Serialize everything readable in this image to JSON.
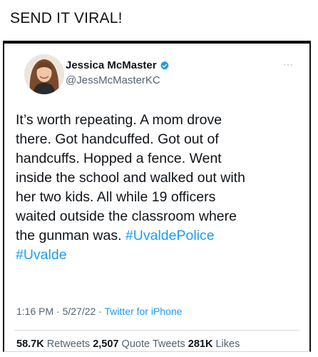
{
  "caption": "SEND IT VIRAL!",
  "tweet": {
    "author_name": "Jessica McMaster",
    "handle": "@JessMcMasterKC",
    "more_label": "···",
    "text_lines": [
      "It’s worth repeating. A mom drove",
      "there. Got handcuffed. Got out of",
      "handcuffs. Hopped a fence. Went",
      "inside the school and walked out with",
      "her two kids. All while 19 officers",
      "waited outside the classroom where",
      "the gunman was. "
    ],
    "hashtag1": "#UvaldePolice",
    "hashtag2": "#Uvalde",
    "time": "1:16 PM",
    "date": "5/27/22",
    "source": "Twitter for iPhone",
    "stats": {
      "retweets": "58.7K",
      "retweets_label": "Retweets",
      "quote_tweets": "2,507",
      "quote_tweets_label": "Quote Tweets",
      "likes": "281K",
      "likes_label": "Likes"
    }
  },
  "colors": {
    "link": "#1d9bf0",
    "secondary_text": "#536471",
    "verified_badge": "#1d9bf0"
  },
  "icons": [
    "verified-badge-icon",
    "more-options-icon"
  ]
}
